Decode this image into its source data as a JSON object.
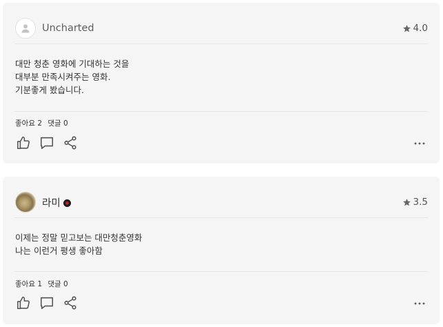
{
  "reviews": [
    {
      "username": "Uncharted",
      "avatar": "default-user-icon",
      "rating": "4.0",
      "lines": [
        "대만 청춘 영화에 기대하는 것을",
        "대부분 만족시켜주는 영화.",
        "기분좋게 봤습니다."
      ],
      "likes_label": "좋아요 2",
      "comments_label": "댓글 0"
    },
    {
      "username": "라미",
      "avatar": "user-photo",
      "badge": "red-badge-icon",
      "rating": "3.5",
      "lines": [
        "이제는 정말 믿고보는 대만청춘영화",
        "나는 이런거 평생 좋아함"
      ],
      "likes_label": "좋아요 1",
      "comments_label": "댓글 0"
    }
  ],
  "icons": [
    "star-icon",
    "like-icon",
    "comment-icon",
    "share-icon",
    "more-icon"
  ],
  "colors": {
    "card_bg": "#f5f5f5",
    "icon": "#555555",
    "star": "#666666",
    "badge": "#b3202a"
  }
}
